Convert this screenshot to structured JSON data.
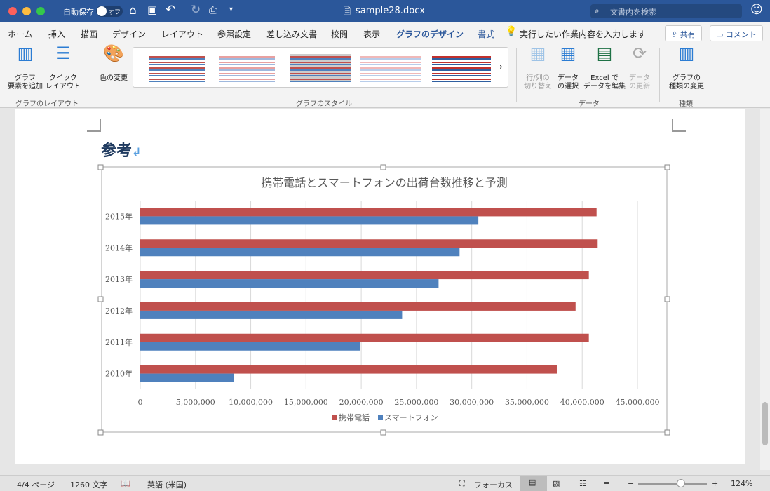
{
  "titlebar": {
    "autosave_label": "自動保存",
    "autosave_state": "オフ",
    "filename": "sample28.docx",
    "search_placeholder": "文書内を検索"
  },
  "tabs": [
    {
      "label": "ホーム"
    },
    {
      "label": "挿入"
    },
    {
      "label": "描画"
    },
    {
      "label": "デザイン"
    },
    {
      "label": "レイアウト"
    },
    {
      "label": "参照設定"
    },
    {
      "label": "差し込み文書"
    },
    {
      "label": "校閲"
    },
    {
      "label": "表示"
    },
    {
      "label": "グラフのデザイン",
      "active": true
    },
    {
      "label": "書式"
    }
  ],
  "tell_me": "実行したい作業内容を入力します",
  "share_label": "共有",
  "comment_label": "コメント",
  "ribbon": {
    "add_element": "グラフ\n要素を追加",
    "quick_layout": "クイック\nレイアウト",
    "group_layout": "グラフのレイアウト",
    "change_color": "色の変更",
    "group_styles": "グラフのスタイル",
    "switch_row_col": "行/列の\n切り替え",
    "select_data": "データ\nの選択",
    "edit_excel": "Excel で\nデータを編集",
    "refresh_data": "データ\nの更新",
    "group_data": "データ",
    "change_type": "グラフの\n種類の変更",
    "group_type": "種類"
  },
  "document": {
    "heading": "参考"
  },
  "chart_data": {
    "type": "bar",
    "orientation": "horizontal",
    "title": "携帯電話とスマートフォンの出荷台数推移と予測",
    "categories": [
      "2010年",
      "2011年",
      "2012年",
      "2013年",
      "2014年",
      "2015年"
    ],
    "series": [
      {
        "name": "携帯電話",
        "color": "#c0504d",
        "values": [
          37700000,
          40600000,
          39400000,
          40600000,
          41400000,
          41300000
        ]
      },
      {
        "name": "スマートフォン",
        "color": "#4f81bd",
        "values": [
          8500000,
          19900000,
          23700000,
          27000000,
          28900000,
          30600000
        ]
      }
    ],
    "xlim": [
      0,
      45000000
    ],
    "xticks": [
      "0",
      "5,000,000",
      "10,000,000",
      "15,000,000",
      "20,000,000",
      "25,000,000",
      "30,000,000",
      "35,000,000",
      "40,000,000",
      "45,000,000"
    ],
    "grid": true,
    "legend": "bottom"
  },
  "status": {
    "page": "4/4 ページ",
    "words": "1260 文字",
    "language": "英語 (米国)",
    "focus": "フォーカス",
    "zoom": "124%",
    "zoom_level": 0.62
  }
}
